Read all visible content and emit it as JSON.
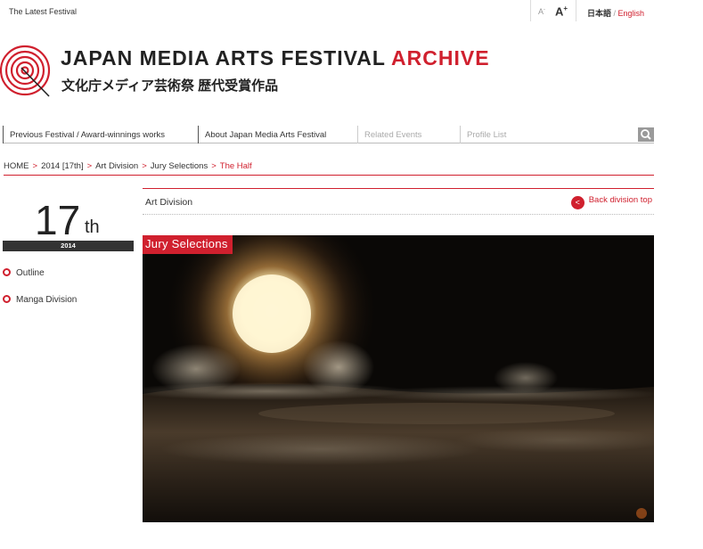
{
  "topbar": {
    "latest_label": "The Latest Festival",
    "font_small": "A",
    "font_small_sign": "-",
    "font_large": "A",
    "font_large_sign": "+",
    "lang_ja": "日本語",
    "lang_sep": " / ",
    "lang_en": "English"
  },
  "header": {
    "title_main": "JAPAN MEDIA ARTS FESTIVAL ",
    "title_archive": "ARCHIVE",
    "title_ja": "文化庁メディア芸術祭 歴代受賞作品"
  },
  "nav": {
    "items": [
      {
        "label": "Previous Festival / Award-winnings works"
      },
      {
        "label": "About Japan Media Arts Festival"
      },
      {
        "label": "Related Events"
      },
      {
        "label": "Profile List"
      }
    ],
    "search_icon": "search-icon"
  },
  "breadcrumb": {
    "items": [
      "HOME",
      "2014 [17th]",
      "Art Division",
      "Jury Selections"
    ],
    "current": "The Half",
    "separator": ">"
  },
  "sidebar": {
    "year_number": "17",
    "year_suffix": "th",
    "year": "2014",
    "links": [
      {
        "label": "Outline"
      },
      {
        "label": "Manga Division"
      }
    ]
  },
  "division": {
    "label": "Art Division",
    "back_label": "Back division top",
    "back_icon": "chevron-left-icon"
  },
  "artwork": {
    "badge": "Jury Selections"
  },
  "colors": {
    "accent": "#d0202e",
    "dark": "#333333",
    "search_bg": "#9a9a9a"
  }
}
